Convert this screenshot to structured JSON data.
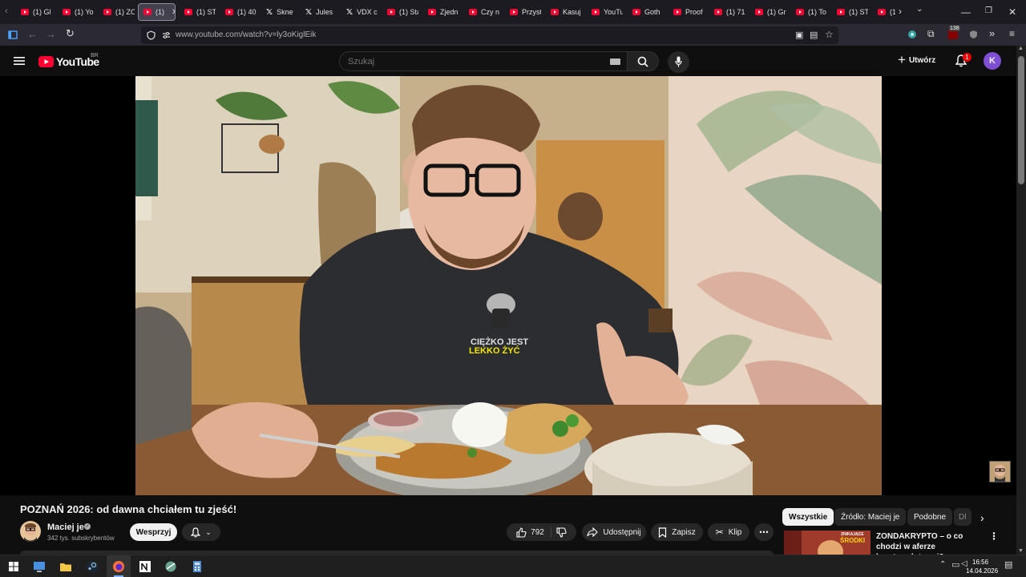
{
  "browser": {
    "tabs": [
      {
        "icon": "youtube-favicon",
        "label": "(1) Gl"
      },
      {
        "icon": "youtube-favicon",
        "label": "(1) Yo"
      },
      {
        "icon": "youtube-favicon",
        "label": "(1) ZO"
      },
      {
        "icon": "youtube-favicon",
        "label": "(1)"
      },
      {
        "icon": "youtube-favicon",
        "label": "(1) ST"
      },
      {
        "icon": "youtube-favicon",
        "label": "(1) 40"
      },
      {
        "icon": "x-favicon",
        "label": "Skne"
      },
      {
        "icon": "x-favicon",
        "label": "Jules"
      },
      {
        "icon": "x-favicon",
        "label": "VDX c"
      },
      {
        "icon": "youtube-favicon",
        "label": "(1) Sta"
      },
      {
        "icon": "youtube-favicon",
        "label": "Zjedn"
      },
      {
        "icon": "youtube-favicon",
        "label": "Czy n"
      },
      {
        "icon": "youtube-favicon",
        "label": "Przyst"
      },
      {
        "icon": "youtube-favicon",
        "label": "Kasuj"
      },
      {
        "icon": "youtube-favicon",
        "label": "YouTu"
      },
      {
        "icon": "youtube-favicon",
        "label": "Goth"
      },
      {
        "icon": "youtube-favicon",
        "label": "Proof"
      },
      {
        "icon": "youtube-favicon",
        "label": "(1) 71"
      },
      {
        "icon": "youtube-favicon",
        "label": "(1) Gr"
      },
      {
        "icon": "youtube-favicon",
        "label": "(1) To"
      },
      {
        "icon": "youtube-favicon",
        "label": "(1) ST"
      },
      {
        "icon": "youtube-favicon",
        "label": "(1)"
      }
    ],
    "url": "www.youtube.com/watch?v=ly3oKiglEik",
    "extension_badge": "138"
  },
  "youtube": {
    "logo_text": "YouTube",
    "logo_region": "BR",
    "search_placeholder": "Szukaj",
    "create_label": "Utwórz",
    "notification_count": "1",
    "avatar_letter": "K"
  },
  "video": {
    "title": "POZNAŃ 2026: od dawna chciałem tu zjeść!",
    "shirt_text_line1": "CIĘŻKO JEST",
    "shirt_text_line2": "LEKKO ŻYĆ"
  },
  "channel": {
    "name": "Maciej je",
    "subscribers": "342 tys. subskrybentów",
    "support_label": "Wesprzyj"
  },
  "actions": {
    "likes": "792",
    "share_label": "Udostępnij",
    "save_label": "Zapisz",
    "clip_label": "Klip"
  },
  "sidebar": {
    "chips": [
      "Wszystkie",
      "Źródło: Maciej je",
      "Podobne",
      "Dl"
    ],
    "recommended": {
      "title": "ZONDAKRYPTO – o co chodzi w aferze kryptowalutowej?",
      "thumb_text1": "ZNIKAJĄCE",
      "thumb_text2": "ŚRODKI"
    }
  },
  "taskbar": {
    "time": "16:56",
    "date": "14.04.2026"
  },
  "colors": {
    "youtube_red": "#ff0033",
    "avatar_purple": "#7e4ed3",
    "background": "#0f0f0f"
  }
}
